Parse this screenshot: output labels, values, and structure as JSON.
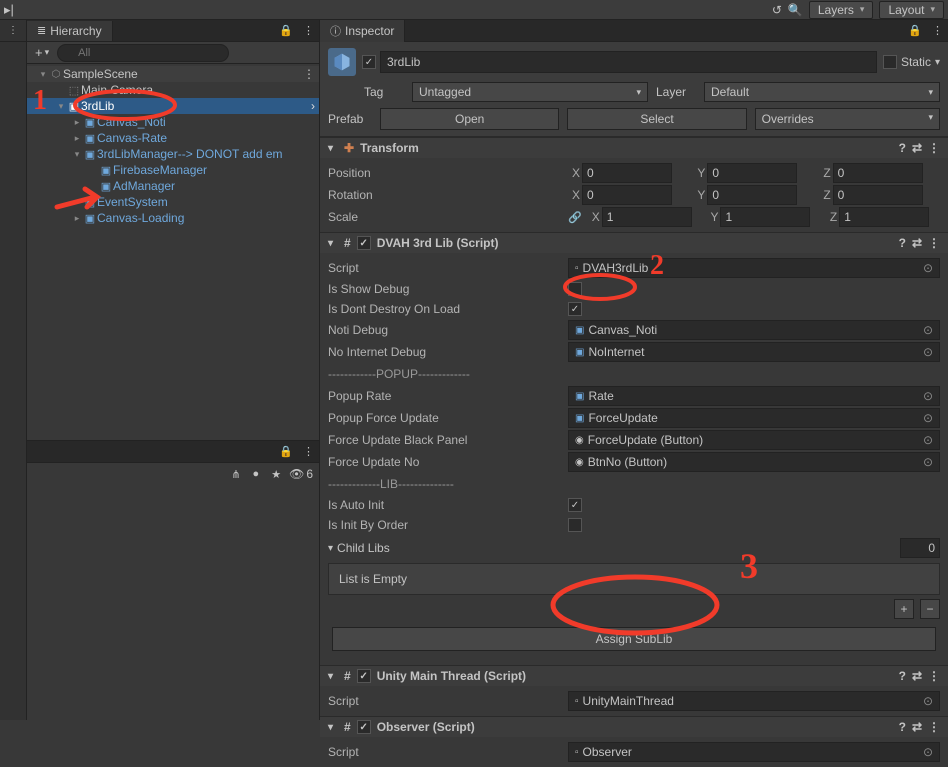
{
  "toolbar": {
    "layers": "Layers",
    "layout": "Layout"
  },
  "hierarchy": {
    "tab": "Hierarchy",
    "search_placeholder": "All",
    "scene": "SampleScene",
    "items": [
      "Main Camera",
      "3rdLib",
      "Canvas_Noti",
      "Canvas-Rate",
      "3rdLibManager--> DONOT add em",
      "FirebaseManager",
      "AdManager",
      "EventSystem",
      "Canvas-Loading"
    ]
  },
  "lower_toolbar": {
    "visible_count": "6"
  },
  "inspector": {
    "tab": "Inspector",
    "name": "3rdLib",
    "static_label": "Static",
    "tag_label": "Tag",
    "tag_value": "Untagged",
    "layer_label": "Layer",
    "layer_value": "Default",
    "prefab_label": "Prefab",
    "open_btn": "Open",
    "select_btn": "Select",
    "overrides_btn": "Overrides",
    "transform": {
      "title": "Transform",
      "position": "Position",
      "rotation": "Rotation",
      "scale": "Scale",
      "pos": {
        "x": "0",
        "y": "0",
        "z": "0"
      },
      "rot": {
        "x": "0",
        "y": "0",
        "z": "0"
      },
      "scl": {
        "x": "1",
        "y": "1",
        "z": "1"
      }
    },
    "dvah": {
      "title": "DVAH 3rd Lib (Script)",
      "script_label": "Script",
      "script_value": "DVAH3rdLib",
      "is_show_debug": "Is Show Debug",
      "is_dont_destroy": "Is Dont Destroy On Load",
      "noti_debug": "Noti Debug",
      "noti_debug_value": "Canvas_Noti",
      "no_internet": "No Internet Debug",
      "no_internet_value": "NoInternet",
      "popup_header": "------------POPUP-------------",
      "popup_rate": "Popup Rate",
      "popup_rate_value": "Rate",
      "popup_force": "Popup Force Update",
      "popup_force_value": "ForceUpdate",
      "force_panel": "Force Update Black Panel",
      "force_panel_value": "ForceUpdate (Button)",
      "force_no": "Force Update No",
      "force_no_value": "BtnNo (Button)",
      "lib_header": "-------------LIB--------------",
      "auto_init": "Is Auto Init",
      "init_order": "Is Init By Order",
      "child_libs": "Child Libs",
      "child_count": "0",
      "list_empty": "List is Empty",
      "assign_btn": "Assign SubLib"
    },
    "umt": {
      "title": "Unity Main Thread (Script)",
      "script_label": "Script",
      "script_value": "UnityMainThread"
    },
    "obs": {
      "title": "Observer (Script)",
      "script_label": "Script",
      "script_value": "Observer"
    }
  },
  "annotations": {
    "a1": "1",
    "a2": "2",
    "a3": "3"
  }
}
